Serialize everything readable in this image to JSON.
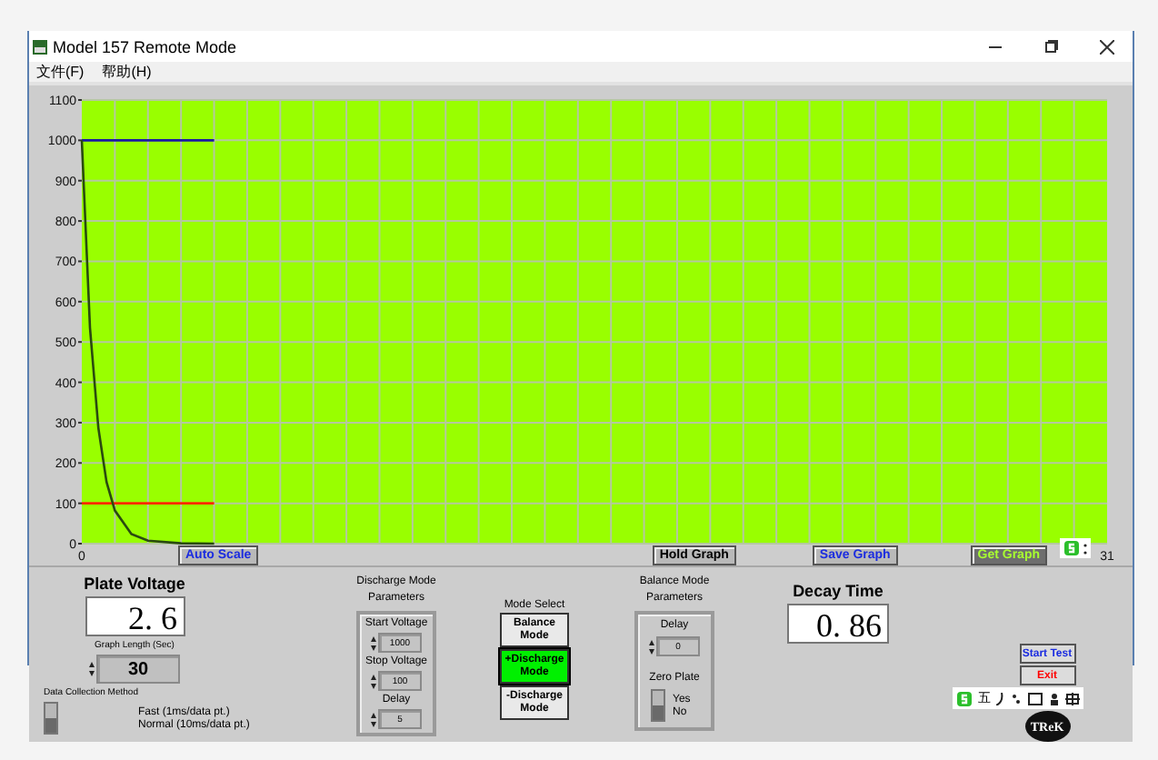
{
  "window": {
    "title": "Model 157 Remote Mode"
  },
  "menu": [
    "文件(F)",
    "帮助(H)"
  ],
  "graph": {
    "chart_data": {
      "type": "line",
      "grid": true,
      "x": [
        0,
        0.25,
        0.5,
        0.75,
        1,
        1.5,
        2,
        3,
        4
      ],
      "xlim": [
        0,
        31
      ],
      "ylim": [
        0,
        1100
      ],
      "xticks": [
        0,
        31
      ],
      "yticks": [
        0,
        100,
        200,
        300,
        400,
        500,
        600,
        700,
        800,
        900,
        1000,
        1100
      ],
      "series": [
        {
          "color": "#1a1aa0",
          "values": [
            1000,
            1000,
            1000,
            1000,
            1000,
            1000,
            1000,
            1000,
            1000
          ]
        },
        {
          "color": "#ff2a00",
          "values": [
            100,
            100,
            100,
            100,
            100,
            100,
            100,
            100,
            100
          ]
        },
        {
          "color": "#2a4a10",
          "values": [
            1000,
            535,
            287,
            153,
            82,
            24,
            7,
            1,
            0
          ]
        }
      ]
    }
  },
  "graph_buttons": [
    {
      "label": "Auto Scale",
      "disabled": false
    },
    {
      "label": "Hold Graph",
      "disabled": false
    },
    {
      "label": "Save Graph",
      "disabled": false
    },
    {
      "label": "Get Graph",
      "disabled": true
    }
  ],
  "plate_voltage": {
    "label": "Plate Voltage",
    "value": "2. 6"
  },
  "graph_length": {
    "label": "Graph Length (Sec)",
    "value": "30"
  },
  "data_collection": {
    "label": "Data Collection Method",
    "options": [
      {
        "label": "Fast (1ms/data pt.)",
        "selected": false
      },
      {
        "label": "Normal (10ms/data pt.)",
        "selected": true
      }
    ]
  },
  "discharge_params": {
    "title": "Discharge Mode Parameters",
    "fields": [
      {
        "label": "Start Voltage",
        "value": "1000"
      },
      {
        "label": "Stop Voltage",
        "value": "100"
      },
      {
        "label": "Delay",
        "value": "5"
      }
    ]
  },
  "mode_select": {
    "label": "Mode Select",
    "modes": [
      {
        "label": "Balance Mode",
        "selected": false
      },
      {
        "label": "+Discharge Mode",
        "selected": true
      },
      {
        "label": "-Discharge Mode",
        "selected": false
      }
    ]
  },
  "balance_params": {
    "title": "Balance Mode Parameters",
    "delay_label": "Delay",
    "delay_value": "0",
    "zero_plate_label": "Zero Plate",
    "options": [
      {
        "label": "Yes",
        "selected": false
      },
      {
        "label": "No",
        "selected": true
      }
    ]
  },
  "decay_time": {
    "label": "Decay Time",
    "value": "0. 86"
  },
  "actions": [
    {
      "label": "Start Test",
      "kind": "start"
    },
    {
      "label": "Exit",
      "kind": "exit"
    }
  ],
  "logo": "TReK",
  "ime_toolbar": {
    "mode": "五"
  }
}
